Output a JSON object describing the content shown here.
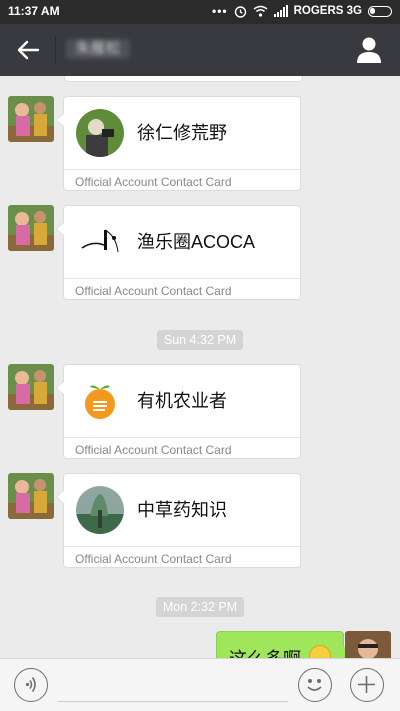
{
  "status_bar": {
    "time": "11:37 AM",
    "dots": "•••",
    "carrier": "ROGERS 3G"
  },
  "header": {
    "title": "朱雁松",
    "icons": [
      "back-arrow-icon",
      "person-icon"
    ]
  },
  "messages": [
    {
      "type": "contact_card",
      "name": "徐仁修荒野",
      "label": "Official Account Contact Card"
    },
    {
      "type": "contact_card",
      "name": "渔乐圈ACOCA",
      "label": "Official Account Contact Card"
    },
    {
      "type": "timestamp",
      "text": "Sun 4:32 PM"
    },
    {
      "type": "contact_card",
      "name": "有机农业者",
      "label": "Official Account Contact Card"
    },
    {
      "type": "contact_card",
      "name": "中草药知识",
      "label": "Official Account Contact Card"
    },
    {
      "type": "timestamp",
      "text": "Mon 2:32 PM"
    },
    {
      "type": "outgoing_text",
      "text": "这么多啊"
    }
  ],
  "colors": {
    "header_bg": "#393a3f",
    "outgoing_bubble": "#9fe65a",
    "chat_bg": "#ebebeb"
  }
}
